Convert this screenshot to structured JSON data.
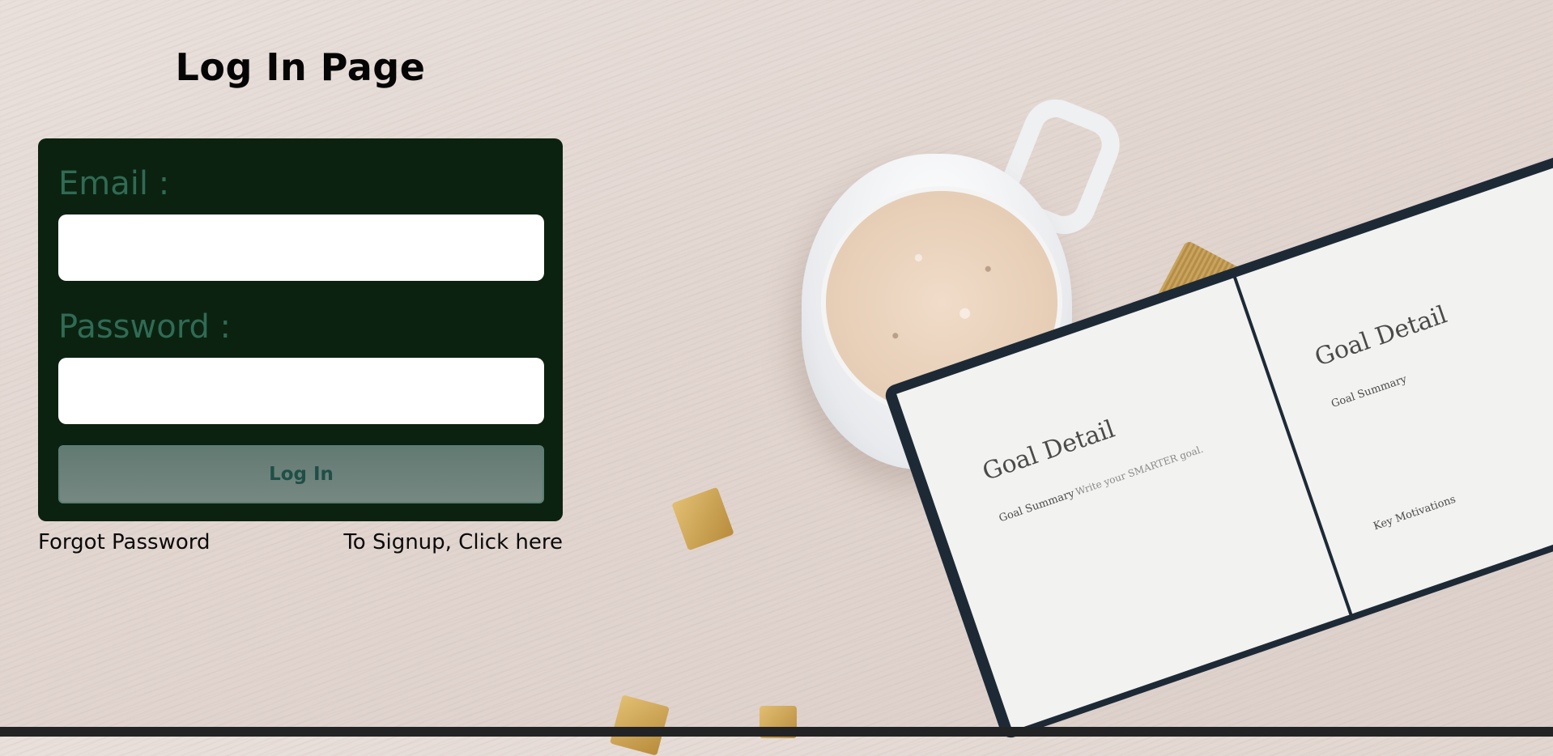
{
  "page": {
    "title": "Log In Page"
  },
  "login_form": {
    "email_label": "Email :",
    "email_value": "",
    "password_label": "Password :",
    "password_value": "",
    "submit_label": "Log In"
  },
  "links": {
    "forgot_password": "Forgot Password",
    "signup": "To Signup, Click here"
  },
  "background": {
    "notebook_heading": "Goal Detail",
    "notebook_subheading": "Goal Summary",
    "notebook_hint": "Write your SMARTER goal.",
    "notebook_motivations": "Key Motivations"
  },
  "colors": {
    "card": "#0c2210",
    "label": "#2f6b55",
    "button": "#6b7f79",
    "button_text": "#1f4f46"
  }
}
